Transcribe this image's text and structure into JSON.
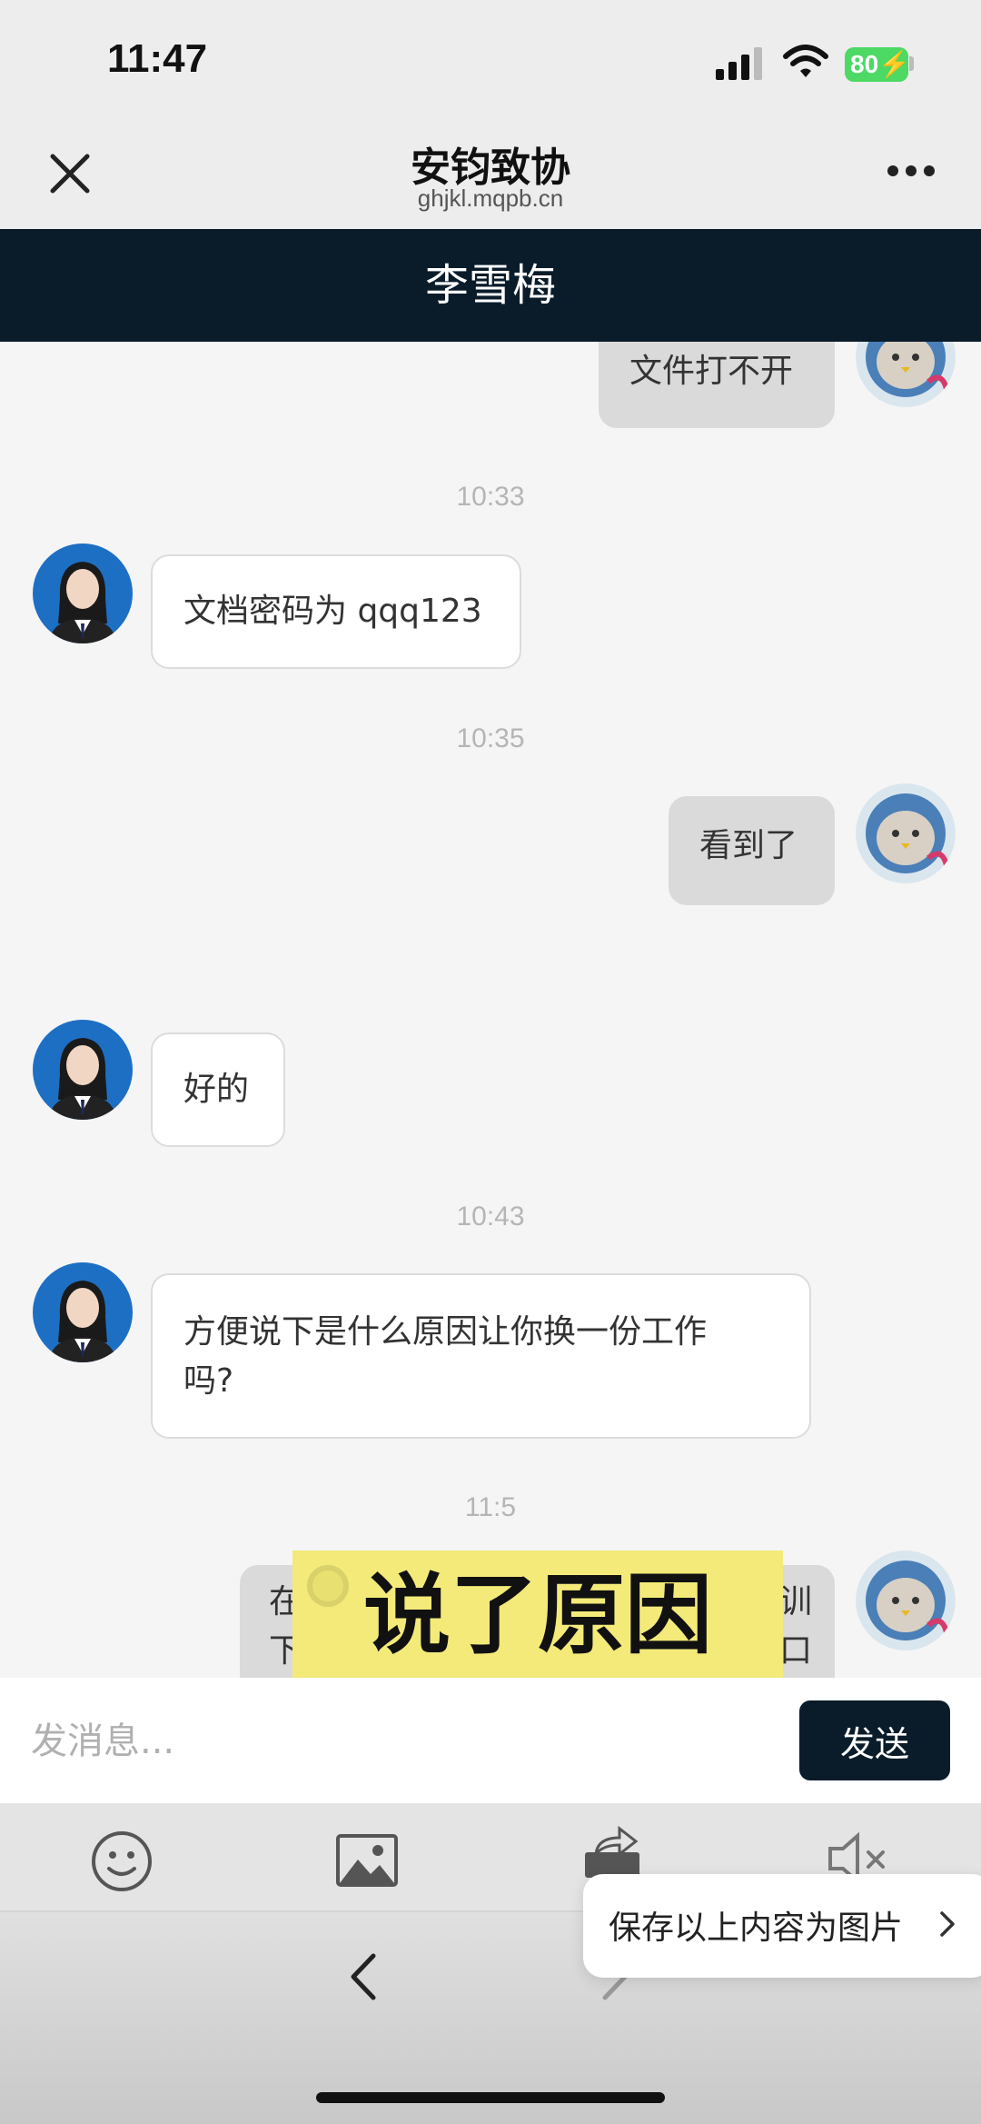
{
  "status_bar": {
    "time": "11:47",
    "battery": "80"
  },
  "header": {
    "title": "安钧致协",
    "url": "ghjkl.mqpb.cn"
  },
  "contact": {
    "name": "李雪梅"
  },
  "messages": [
    {
      "direction": "out",
      "text": "文件打不开"
    },
    {
      "timestamp": "10:33"
    },
    {
      "direction": "in",
      "text": "文档密码为 qqq123"
    },
    {
      "timestamp": "10:35"
    },
    {
      "direction": "out",
      "text": "看到了"
    },
    {
      "direction": "in",
      "text": "好的"
    },
    {
      "timestamp": "10:43"
    },
    {
      "direction": "in",
      "text_line1": "方便说下是什么原因让你换一份工作",
      "text_line2": "吗?"
    },
    {
      "timestamp": "11:5"
    },
    {
      "direction": "out",
      "text_partial_left": "在",
      "text_partial_left2": "下",
      "text_partial_right": "训",
      "text_partial_right2": "口"
    }
  ],
  "overlay": {
    "caption": "说了原因"
  },
  "input": {
    "placeholder": "发消息...",
    "send_label": "发送"
  },
  "toolbar": {
    "icons": [
      "emoji-icon",
      "image-icon",
      "share-icon",
      "mute-icon"
    ]
  },
  "popup": {
    "save_label": "保存以上内容为图片"
  },
  "colors": {
    "accent": "#0a1c2a",
    "caption_bg": "#f3ea7a",
    "battery": "#4cd964"
  }
}
